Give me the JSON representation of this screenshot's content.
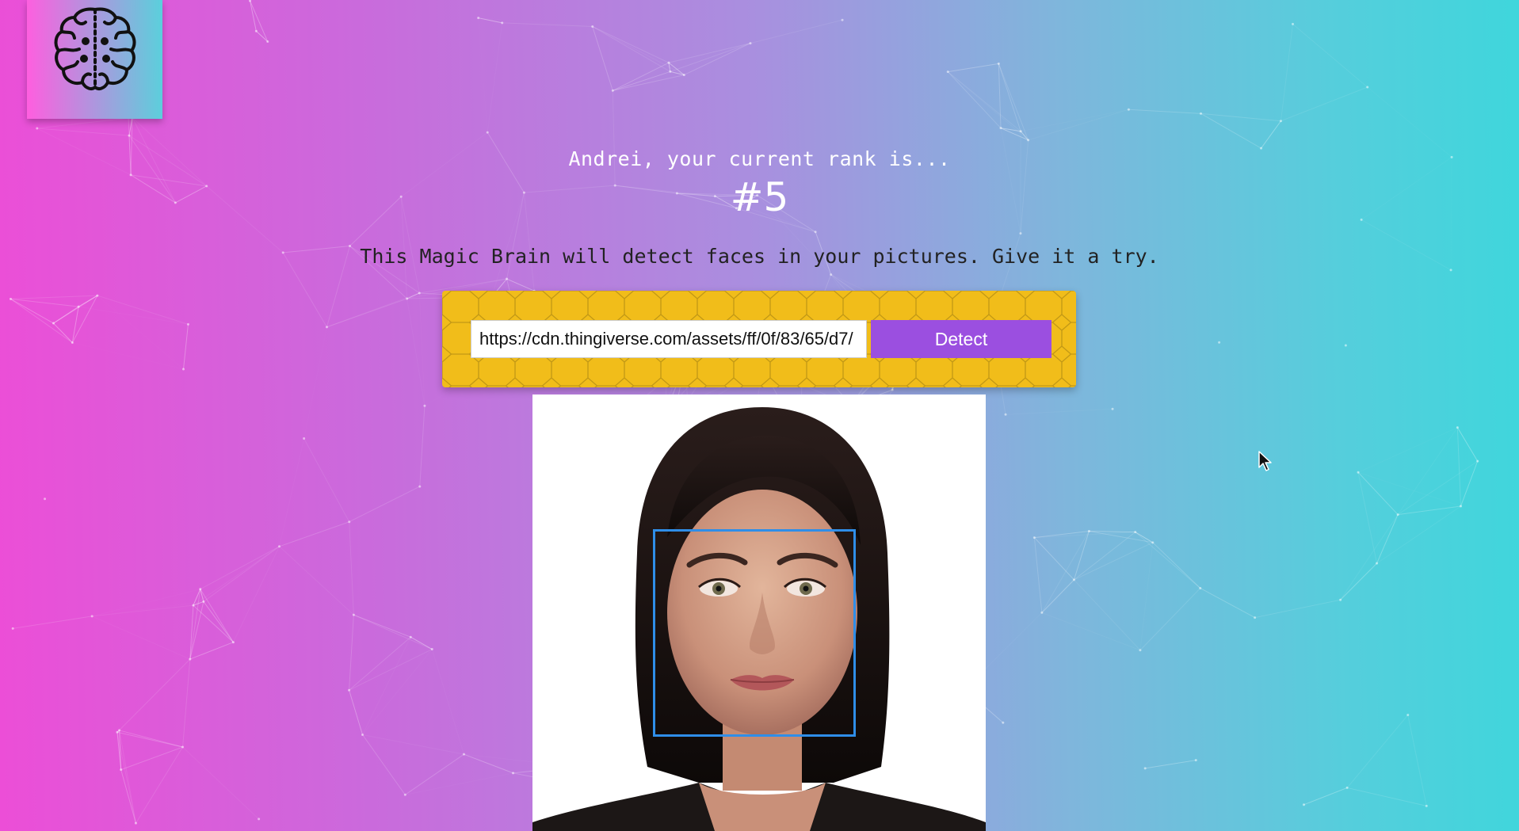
{
  "logo": {
    "icon": "brain-icon"
  },
  "rank": {
    "message": "Andrei, your current rank is...",
    "value": "#5"
  },
  "tagline": "This Magic Brain will detect faces in your pictures. Give it a try.",
  "form": {
    "url_value": "https://cdn.thingiverse.com/assets/ff/0f/83/65/d7/",
    "button_label": "Detect"
  },
  "result": {
    "face_box_count": 1
  },
  "colors": {
    "gradient_left": "#ec4ed7",
    "gradient_right": "#3fd6dc",
    "panel": "#f1bd1a",
    "button": "#9b4fe0",
    "face_box": "#2f8ee8"
  }
}
